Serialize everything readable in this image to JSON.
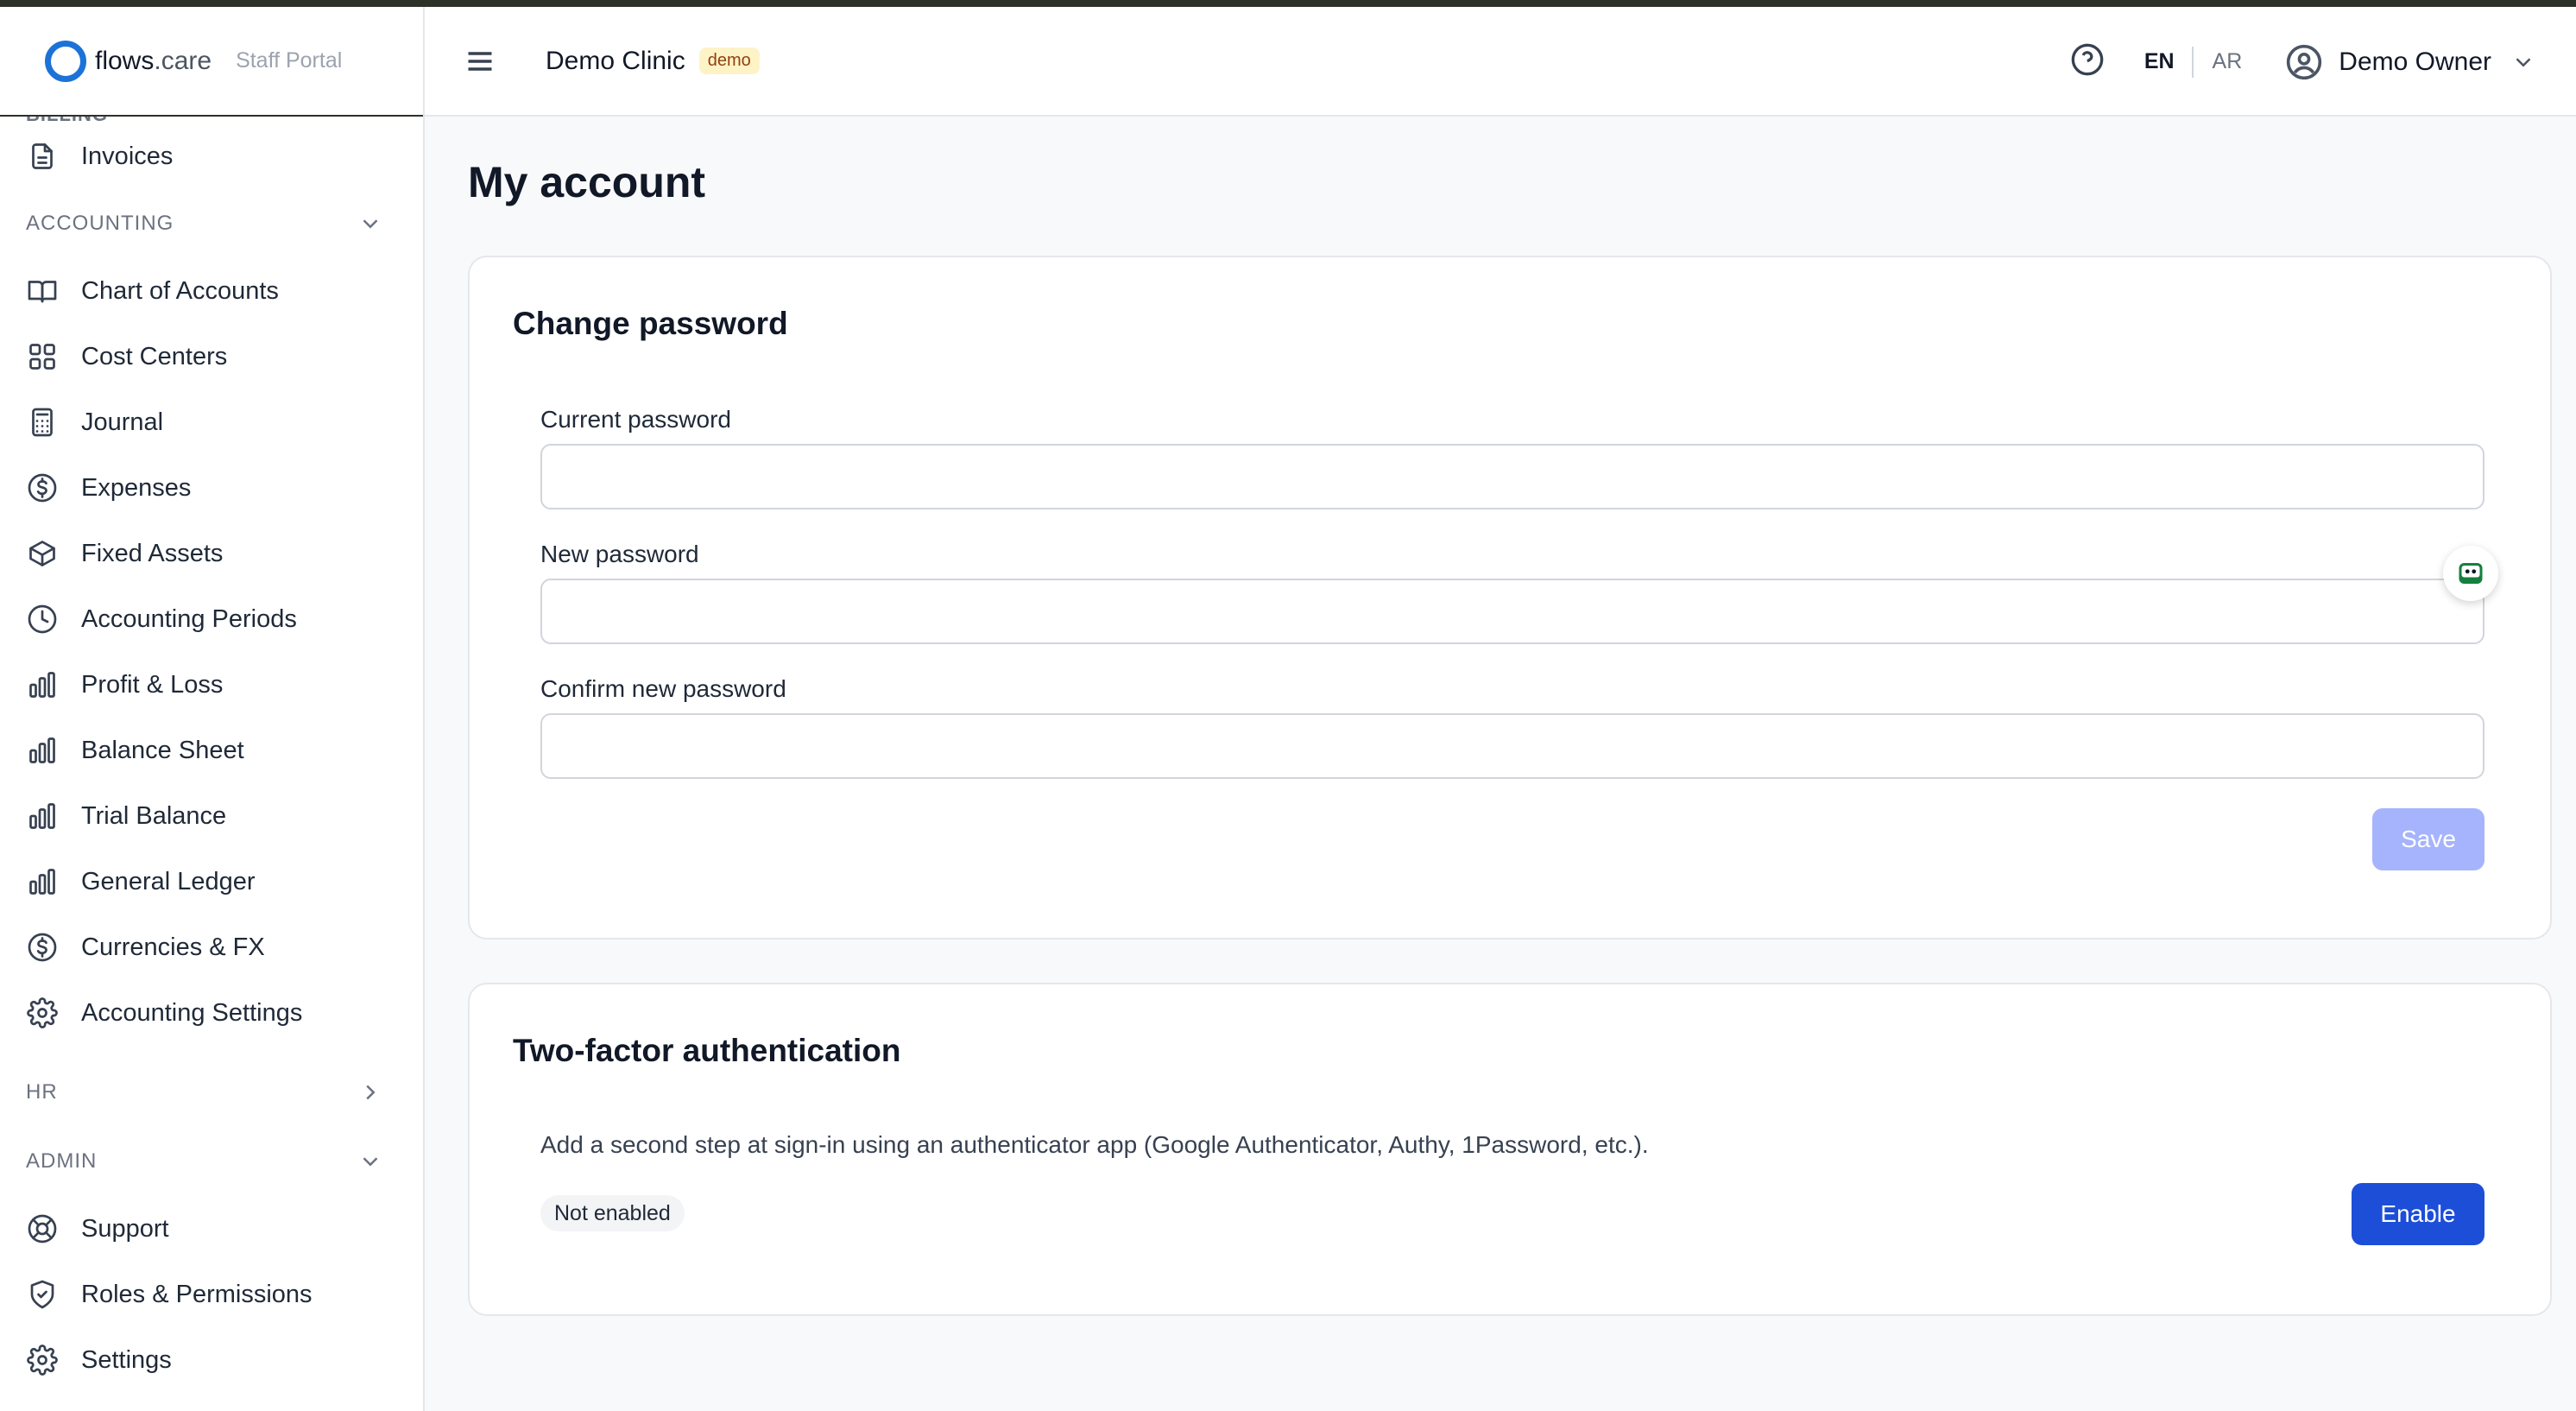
{
  "brand": {
    "name": "flows",
    "domain": ".care",
    "portal": "Staff Portal"
  },
  "sidebar": {
    "partial_section": "BILLING",
    "top_items": [
      {
        "label": "Invoices",
        "icon": "document-icon"
      }
    ],
    "accounting_label": "ACCOUNTING",
    "accounting_items": [
      {
        "label": "Chart of Accounts",
        "icon": "book-icon"
      },
      {
        "label": "Cost Centers",
        "icon": "grid-icon"
      },
      {
        "label": "Journal",
        "icon": "calculator-icon"
      },
      {
        "label": "Expenses",
        "icon": "dollar-icon"
      },
      {
        "label": "Fixed Assets",
        "icon": "box-icon"
      },
      {
        "label": "Accounting Periods",
        "icon": "clock-icon"
      },
      {
        "label": "Profit & Loss",
        "icon": "bar-chart-icon"
      },
      {
        "label": "Balance Sheet",
        "icon": "bar-chart-icon"
      },
      {
        "label": "Trial Balance",
        "icon": "bar-chart-icon"
      },
      {
        "label": "General Ledger",
        "icon": "bar-chart-icon"
      },
      {
        "label": "Currencies & FX",
        "icon": "dollar-icon"
      },
      {
        "label": "Accounting Settings",
        "icon": "gear-icon"
      }
    ],
    "hr_label": "HR",
    "admin_label": "ADMIN",
    "admin_items": [
      {
        "label": "Support",
        "icon": "lifebuoy-icon"
      },
      {
        "label": "Roles & Permissions",
        "icon": "shield-icon"
      },
      {
        "label": "Settings",
        "icon": "gear-icon"
      }
    ]
  },
  "header": {
    "clinic": "Demo Clinic",
    "badge": "demo",
    "lang_active": "EN",
    "lang_inactive": "AR",
    "user": "Demo Owner"
  },
  "main": {
    "title": "My account",
    "change_password": {
      "title": "Change password",
      "current_label": "Current password",
      "new_label": "New password",
      "confirm_label": "Confirm new password",
      "current_value": "",
      "new_value": "",
      "confirm_value": "",
      "save_label": "Save"
    },
    "two_factor": {
      "title": "Two-factor authentication",
      "description": "Add a second step at sign-in using an authenticator app (Google Authenticator, Authy, 1Password, etc.).",
      "status": "Not enabled",
      "enable_label": "Enable"
    }
  },
  "colors": {
    "primary": "#1d4ed8",
    "primary_disabled": "#a5b4fc",
    "logo": "#1d72d8"
  }
}
